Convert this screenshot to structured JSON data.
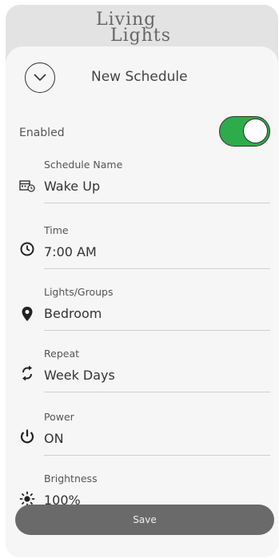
{
  "brand": {
    "line1": "Living",
    "line2": "Lights"
  },
  "header": {
    "title": "New Schedule",
    "back_icon": "chevron-down-icon"
  },
  "enabled": {
    "label": "Enabled",
    "on": true,
    "color_on": "#2eab4a"
  },
  "fields": [
    {
      "label": "Schedule Name",
      "value": "Wake Up",
      "icon": "calendar-clock-icon"
    },
    {
      "label": "Time",
      "value": "7:00 AM",
      "icon": "clock-icon"
    },
    {
      "label": "Lights/Groups",
      "value": "Bedroom",
      "icon": "location-pin-icon"
    },
    {
      "label": "Repeat",
      "value": "Week Days",
      "icon": "repeat-icon"
    },
    {
      "label": "Power",
      "value": "ON",
      "icon": "power-icon"
    },
    {
      "label": "Brightness",
      "value": "100%",
      "icon": "brightness-icon"
    }
  ],
  "save": {
    "label": "Save"
  }
}
